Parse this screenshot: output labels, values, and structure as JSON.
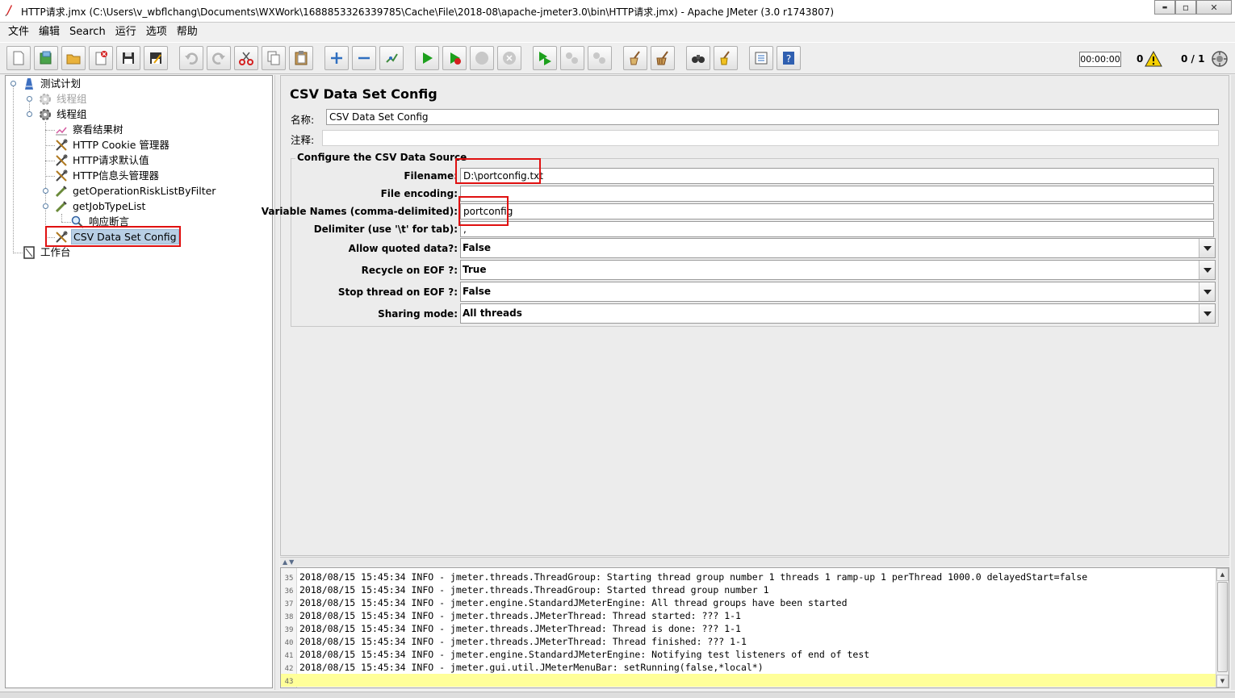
{
  "window": {
    "title": "HTTP请求.jmx (C:\\Users\\v_wbflchang\\Documents\\WXWork\\1688853326339785\\Cache\\File\\2018-08\\apache-jmeter3.0\\bin\\HTTP请求.jmx) - Apache JMeter (3.0 r1743807)",
    "minimize": "▬",
    "maximize": "▫",
    "close": "✕"
  },
  "menubar": [
    "文件",
    "编辑",
    "Search",
    "运行",
    "选项",
    "帮助"
  ],
  "toolbar": {
    "timer": "00:00:00",
    "error_count": "0",
    "thread_count": "0 / 1"
  },
  "tree": {
    "nodes": [
      {
        "label": "测试计划",
        "icon": "test-plan-icon"
      },
      {
        "label": "线程组",
        "icon": "thread-group-icon",
        "disabled": true
      },
      {
        "label": "线程组",
        "icon": "thread-group-icon"
      },
      {
        "label": "察看结果树",
        "icon": "listener-icon"
      },
      {
        "label": "HTTP Cookie 管理器",
        "icon": "config-icon"
      },
      {
        "label": "HTTP请求默认值",
        "icon": "config-icon"
      },
      {
        "label": "HTTP信息头管理器",
        "icon": "config-icon"
      },
      {
        "label": "getOperationRiskListByFilter",
        "icon": "sampler-icon"
      },
      {
        "label": "getJobTypeList",
        "icon": "sampler-icon"
      },
      {
        "label": "响应断言",
        "icon": "assertion-icon"
      },
      {
        "label": "CSV Data Set Config",
        "icon": "config-icon",
        "selected": true
      },
      {
        "label": "工作台",
        "icon": "workbench-icon"
      }
    ]
  },
  "panel": {
    "title": "CSV Data Set Config",
    "name_label": "名称:",
    "name_value": "CSV Data Set Config",
    "comment_label": "注释:",
    "comment_value": "",
    "group_title": "Configure the CSV Data Source",
    "fields": {
      "filename_label": "Filename:",
      "filename_value": "D:\\portconfig.txt",
      "encoding_label": "File encoding:",
      "encoding_value": "",
      "varnames_label": "Variable Names (comma-delimited):",
      "varnames_value": "portconfig",
      "delimiter_label": "Delimiter (use '\\t' for tab):",
      "delimiter_value": ",",
      "quoted_label": "Allow quoted data?:",
      "quoted_value": "False",
      "recycle_label": "Recycle on EOF ?:",
      "recycle_value": "True",
      "stopthread_label": "Stop thread on EOF ?:",
      "stopthread_value": "False",
      "sharing_label": "Sharing mode:",
      "sharing_value": "All threads"
    }
  },
  "log": {
    "divider_arrows": "▲▼",
    "lines": [
      {
        "n": "35",
        "text": "2018/08/15 15:45:34 INFO  - jmeter.threads.ThreadGroup: Starting thread group number 1 threads 1 ramp-up 1 perThread 1000.0 delayedStart=false"
      },
      {
        "n": "36",
        "text": "2018/08/15 15:45:34 INFO  - jmeter.threads.ThreadGroup: Started thread group number 1"
      },
      {
        "n": "37",
        "text": "2018/08/15 15:45:34 INFO  - jmeter.engine.StandardJMeterEngine: All thread groups have been started"
      },
      {
        "n": "38",
        "text": "2018/08/15 15:45:34 INFO  - jmeter.threads.JMeterThread: Thread started: ??? 1-1"
      },
      {
        "n": "39",
        "text": "2018/08/15 15:45:34 INFO  - jmeter.threads.JMeterThread: Thread is done: ??? 1-1"
      },
      {
        "n": "40",
        "text": "2018/08/15 15:45:34 INFO  - jmeter.threads.JMeterThread: Thread finished: ??? 1-1"
      },
      {
        "n": "41",
        "text": "2018/08/15 15:45:34 INFO  - jmeter.engine.StandardJMeterEngine: Notifying test listeners of end of test"
      },
      {
        "n": "42",
        "text": "2018/08/15 15:45:34 INFO  - jmeter.gui.util.JMeterMenuBar: setRunning(false,*local*)"
      },
      {
        "n": "43",
        "text": ""
      }
    ]
  },
  "colors": {
    "highlight_box": "#e01010",
    "selection": "#b8cfe5",
    "current_log_line": "#ffff99"
  }
}
